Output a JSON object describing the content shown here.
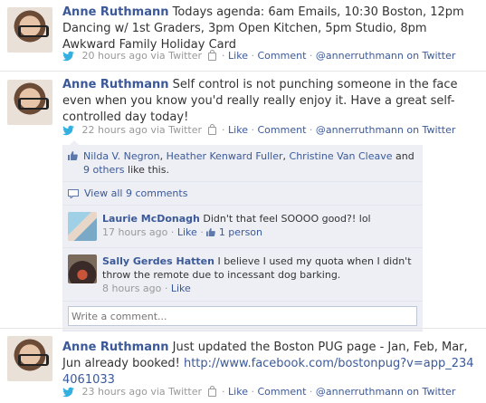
{
  "posts": [
    {
      "author": "Anne Ruthmann",
      "text": "Todays agenda: 6am Emails, 10:30 Boston, 12pm Dancing w/ 1st Graders, 3pm Open Kitchen, 5pm Studio, 8pm Awkward Family Holiday Card",
      "time": "20 hours ago via Twitter",
      "like": "Like",
      "comment": "Comment",
      "source": "@annerruthmann on Twitter"
    },
    {
      "author": "Anne Ruthmann",
      "text": "Self control is not punching someone in the face even when you know you'd really really enjoy it. Have a great self-controlled day today!",
      "time": "22 hours ago via Twitter",
      "like": "Like",
      "comment": "Comment",
      "source": "@annerruthmann on Twitter"
    },
    {
      "author": "Anne Ruthmann",
      "text": "Just updated the Boston PUG page - Jan, Feb, Mar, Jun already booked!",
      "link": "http://www.facebook.com/bostonpug?v=app_2344061033",
      "time": "23 hours ago via Twitter",
      "like": "Like",
      "comment": "Comment",
      "source": "@annerruthmann on Twitter"
    }
  ],
  "feedback": {
    "likers": [
      "Nilda V. Negron",
      "Heather Kenward Fuller",
      "Christine Van Cleave"
    ],
    "others": "9 others",
    "likes_suffix": "like this.",
    "view_all": "View all 9 comments",
    "comments": [
      {
        "name": "Laurie McDonagh",
        "text": "Didn't that feel SOOOO good?! lol",
        "time": "17 hours ago",
        "like": "Like",
        "likes": "1 person"
      },
      {
        "name": "Sally Gerdes Hatten",
        "text": "I believe I used my quota when I didn't throw the remote due to incessant dog barking.",
        "time": "8 hours ago",
        "like": "Like"
      }
    ],
    "placeholder": "Write a comment..."
  },
  "colors": {
    "link": "#3b5998",
    "meta": "#999999",
    "ufi_bg": "#edeff4"
  },
  "icons": [
    "twitter-bird-icon",
    "lock-icon",
    "thumbs-up-icon",
    "comment-bubble-icon"
  ]
}
